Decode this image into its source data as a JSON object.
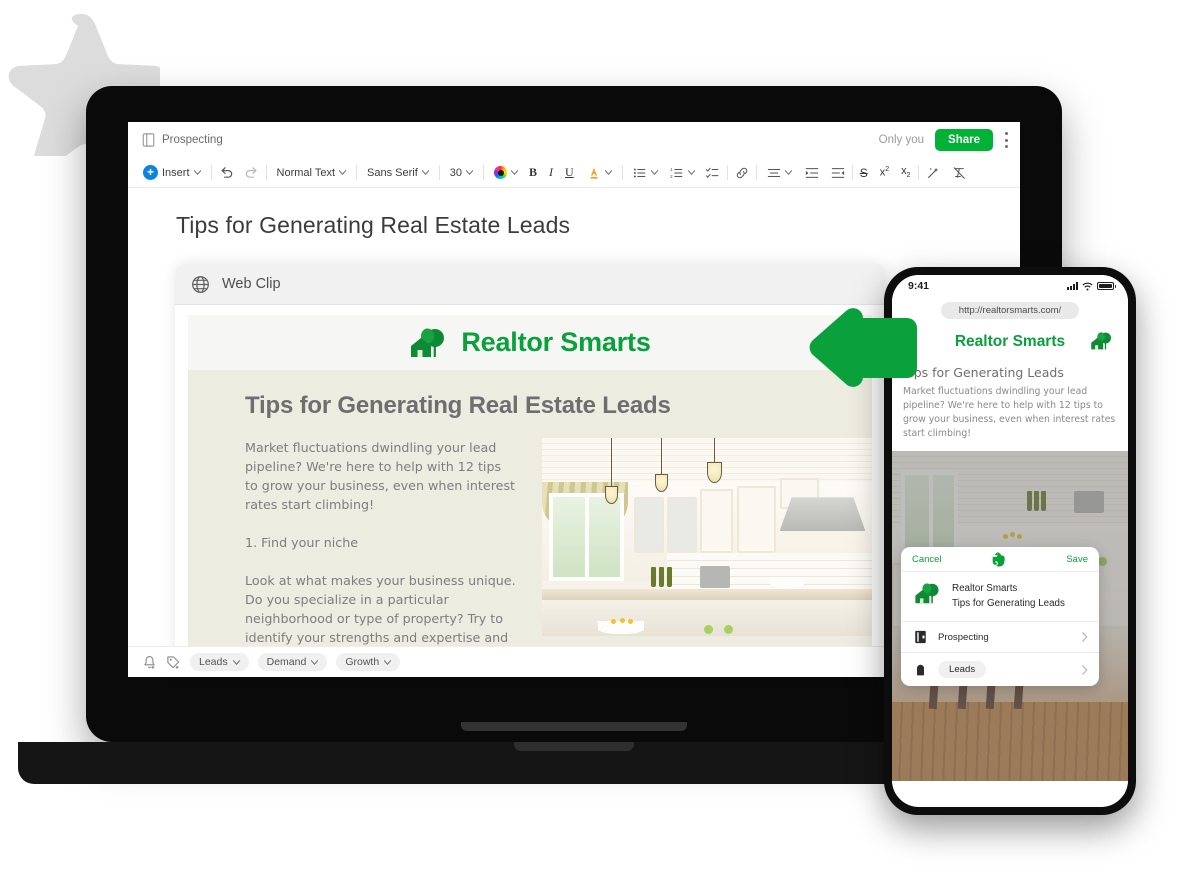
{
  "doc_app": {
    "notebook_name": "Prospecting",
    "notebook_icon": "notebook-icon",
    "sharing_status": "Only you",
    "share_label": "Share",
    "more_icon": "kebab-menu-icon",
    "toolbar": {
      "insert_label": "Insert",
      "insert_icon": "plus-circle-icon",
      "undo_icon": "undo-icon",
      "redo_icon": "redo-icon",
      "paragraph_style": "Normal Text",
      "font_family": "Sans Serif",
      "font_size": "30",
      "color_icon": "color-wheel-icon",
      "bold": "B",
      "italic": "I",
      "underline": "U",
      "highlight_icon": "highlight-icon",
      "bullet_list_icon": "bulleted-list-icon",
      "numbered_list_icon": "numbered-list-icon",
      "checklist_icon": "checklist-icon",
      "link_icon": "link-icon",
      "align_icon": "align-icon",
      "indent_icon": "indent-increase-icon",
      "outdent_icon": "indent-decrease-icon",
      "strikethrough": "S",
      "superscript": "x",
      "superscript_exp": "2",
      "subscript": "x",
      "subscript_exp": "2",
      "magic_icon": "sparkle-wand-icon",
      "clear_format_icon": "clear-formatting-icon"
    },
    "document_heading": "Tips for Generating Real Estate Leads",
    "bottom_bar": {
      "reminder_icon": "add-reminder-icon",
      "tag_add_icon": "add-tag-icon",
      "tags": [
        {
          "label": "Leads"
        },
        {
          "label": "Demand"
        },
        {
          "label": "Growth"
        }
      ]
    }
  },
  "web_clip": {
    "header_icon": "globe-icon",
    "header_title": "Web Clip",
    "brand_name": "Realtor Smarts",
    "brand_logo_icon": "house-trees-logo-icon",
    "article_heading": "Tips for Generating Real Estate Leads",
    "paragraphs": [
      "Market fluctuations dwindling your lead pipeline? We're here to help with 12 tips to grow your business, even when interest rates start climbing!",
      "1. Find your niche",
      "Look at what makes your business unique. Do you specialize in a particular neighborhood or type of property? Try to identify your strengths and expertise and then lean into them. The goal here is to become the go-to realtor for a specific (but not"
    ],
    "image_alt": "modern-white-kitchen-photo"
  },
  "arrow": {
    "icon": "left-pointing-arrow",
    "color": "#0aa03c"
  },
  "phone": {
    "status": {
      "time": "9:41",
      "signal_icon": "cellular-signal-icon",
      "wifi_icon": "wifi-icon",
      "battery_icon": "battery-full-icon"
    },
    "url": "http://realtorsmarts.com/",
    "page": {
      "brand_name": "Realtor Smarts",
      "brand_logo_icon": "house-trees-logo-icon",
      "heading": "Tips for Generating Leads",
      "body": "Market fluctuations dwindling your lead pipeline? We're here to help with 12 tips to grow your business, even when interest rates start climbing!"
    },
    "sheet": {
      "cancel_label": "Cancel",
      "app_icon": "evernote-elephant-icon",
      "save_label": "Save",
      "note_logo_icon": "house-trees-logo-icon",
      "note_source": "Realtor Smarts",
      "note_title": "Tips for Generating Leads",
      "rows": [
        {
          "icon": "notebook-icon",
          "label": "Prospecting",
          "is_tag": false,
          "chevron": "chevron-right-icon"
        },
        {
          "icon": "tag-icon",
          "label": "Leads",
          "is_tag": true,
          "chevron": "chevron-right-icon"
        }
      ]
    }
  },
  "decoration": {
    "star_icon": "rounded-star-shape",
    "star_color": "#dcdcdc"
  },
  "theme": {
    "brand_green": "#0aa03c",
    "share_green": "#00b336",
    "device_black": "#0a0a0a"
  }
}
